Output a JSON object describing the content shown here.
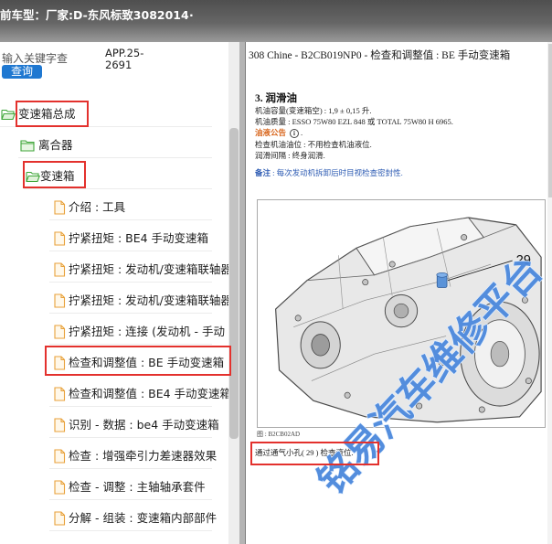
{
  "header": {
    "vehicle_label": "前车型：",
    "maker": "厂家:D-东风标致3082014",
    "trailing": "."
  },
  "search": {
    "placeholder": "输入关键字查",
    "button_label": "查询",
    "app_code": "APP.25-2691"
  },
  "tree": {
    "rows": [
      {
        "label": "变速箱总成",
        "type": "folder",
        "expanded": true,
        "highlighted": true
      },
      {
        "label": "离合器",
        "type": "folder",
        "expanded": false
      },
      {
        "label": "变速箱",
        "type": "folder",
        "expanded": true,
        "highlighted": true
      },
      {
        "label": "介绍 : 工具",
        "type": "document"
      },
      {
        "label": "拧紧扭矩 : BE4 手动变速箱",
        "type": "document"
      },
      {
        "label": "拧紧扭矩 : 发动机/变速箱联轴器",
        "type": "document"
      },
      {
        "label": "拧紧扭矩 : 发动机/变速箱联轴器",
        "type": "document"
      },
      {
        "label": "拧紧扭矩 : 连接 (发动机 - 手动",
        "type": "document"
      },
      {
        "label": "检查和调整值 : BE 手动变速箱",
        "type": "document",
        "highlighted": true,
        "selected": true
      },
      {
        "label": "检查和调整值 : BE4 手动变速箱",
        "type": "document"
      },
      {
        "label": "识别 - 数据 : be4 手动变速箱",
        "type": "document"
      },
      {
        "label": "检查 : 增强牵引力差速器效果",
        "type": "document"
      },
      {
        "label": "检查 - 调整 : 主轴轴承套件",
        "type": "document"
      },
      {
        "label": "分解 - 组装 : 变速箱内部部件",
        "type": "document"
      }
    ]
  },
  "document": {
    "title": "308 Chine - B2CB019NP0 - 检查和调整值 : BE 手动变速箱",
    "section_heading": "3. 润滑油",
    "oil_capacity": "机油容量(变速箱空) : 1,9 ± 0,15 升.",
    "oil_grade": "机油质量 : ESSO 75W80 EZL 848 或 TOTAL 75W80 H 6965.",
    "notice_label": "油液公告",
    "notice_trailing": ".",
    "level_check": "检查机油油位 : 不用检查机油液位.",
    "interval": "润滑间隔 : 终身润滑.",
    "remark_label": "备注",
    "remark_text": " : 每次发动机拆卸后时目视检查密封性.",
    "figure": {
      "callout": "29",
      "caption": "图 : B2CB02AD",
      "watermark": "铭易汽车维修平台"
    },
    "figure_note": "通过通气小孔( 29 ) 检查液位."
  },
  "icons": {
    "folder": "folder-icon",
    "folder_open": "folder-open-icon",
    "document": "document-icon",
    "info": "info-icon"
  },
  "colors": {
    "header_bg": "#666666",
    "search_button": "#1f78d1",
    "highlight": "#e3312d",
    "folder": "#3fa63a",
    "document_icon": "#e8a13a",
    "notice": "#d8651b",
    "remark": "#2d5bb3",
    "watermark": "#3f7fd8",
    "breather_part": "#5b93d8"
  }
}
